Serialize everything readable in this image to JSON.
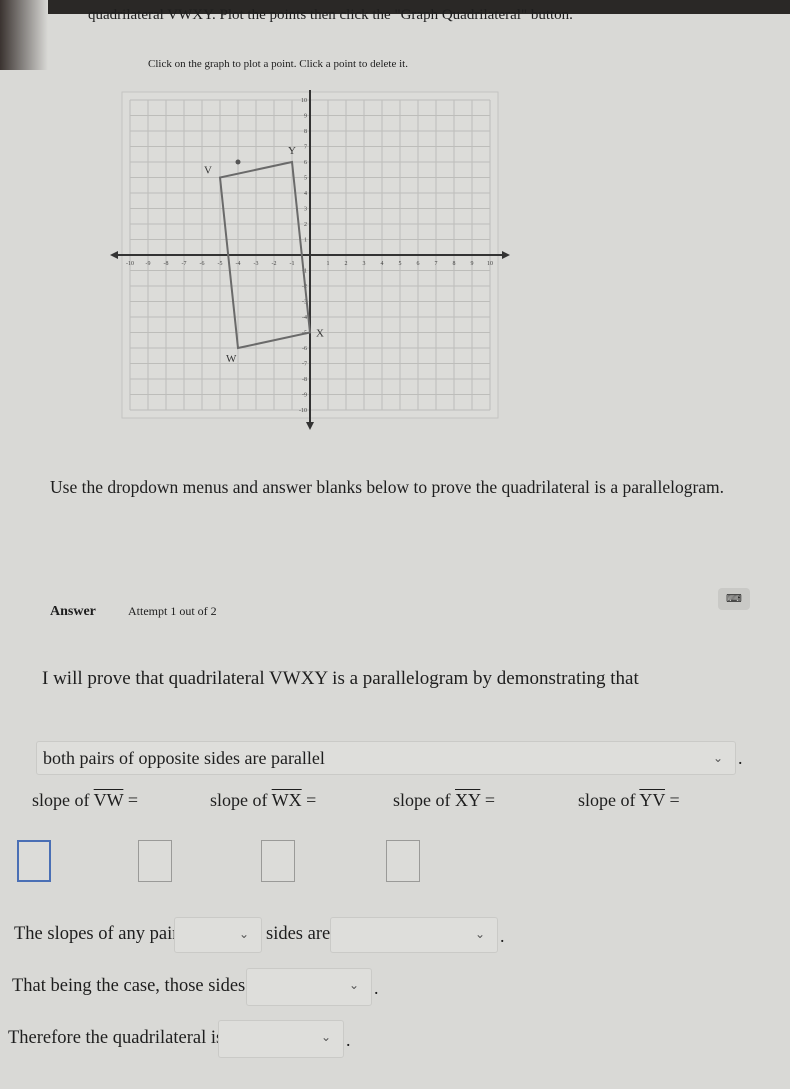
{
  "instructions": {
    "line1": "quadrilateral VWXY. Plot the points then click the \"Graph Quadrilateral\" button.",
    "line2": "Click on the graph to plot a point. Click a point to delete it."
  },
  "graph": {
    "x_range": [
      -10,
      10
    ],
    "y_range": [
      -10,
      10
    ],
    "tick_step": 1,
    "quadrilateral": [
      {
        "label": "V",
        "x": -5,
        "y": 5
      },
      {
        "label": "W",
        "x": -4,
        "y": -6
      },
      {
        "label": "X",
        "x": 0,
        "y": -5
      },
      {
        "label": "Y",
        "x": -1,
        "y": 6
      }
    ],
    "stray_point": {
      "x": -4,
      "y": 6
    },
    "line_color": "#6a6a6a"
  },
  "prompt": "Use the dropdown menus and answer blanks below to prove the quadrilateral is a parallelogram.",
  "answer": {
    "label": "Answer",
    "attempt": "Attempt 1 out of 2",
    "keyboard_icon": "keyboard-icon",
    "prove_text": "I will prove that quadrilateral VWXY is a parallelogram by demonstrating that",
    "method_select": "both pairs of opposite sides are parallel",
    "slopes": [
      {
        "prefix": "slope of ",
        "segment": "VW",
        "suffix": " =",
        "value": ""
      },
      {
        "prefix": "slope of ",
        "segment": "WX",
        "suffix": " =",
        "value": ""
      },
      {
        "prefix": "slope of ",
        "segment": "XY",
        "suffix": " =",
        "value": ""
      },
      {
        "prefix": "slope of ",
        "segment": "YV",
        "suffix": " =",
        "value": ""
      }
    ],
    "sentence1_a": "The slopes of any pair of",
    "sentence1_b": "sides are",
    "sentence2": "That being the case, those sides are",
    "sentence3": "Therefore the quadrilateral is a",
    "period": ".",
    "active_border_color": "#4a6fb5"
  }
}
